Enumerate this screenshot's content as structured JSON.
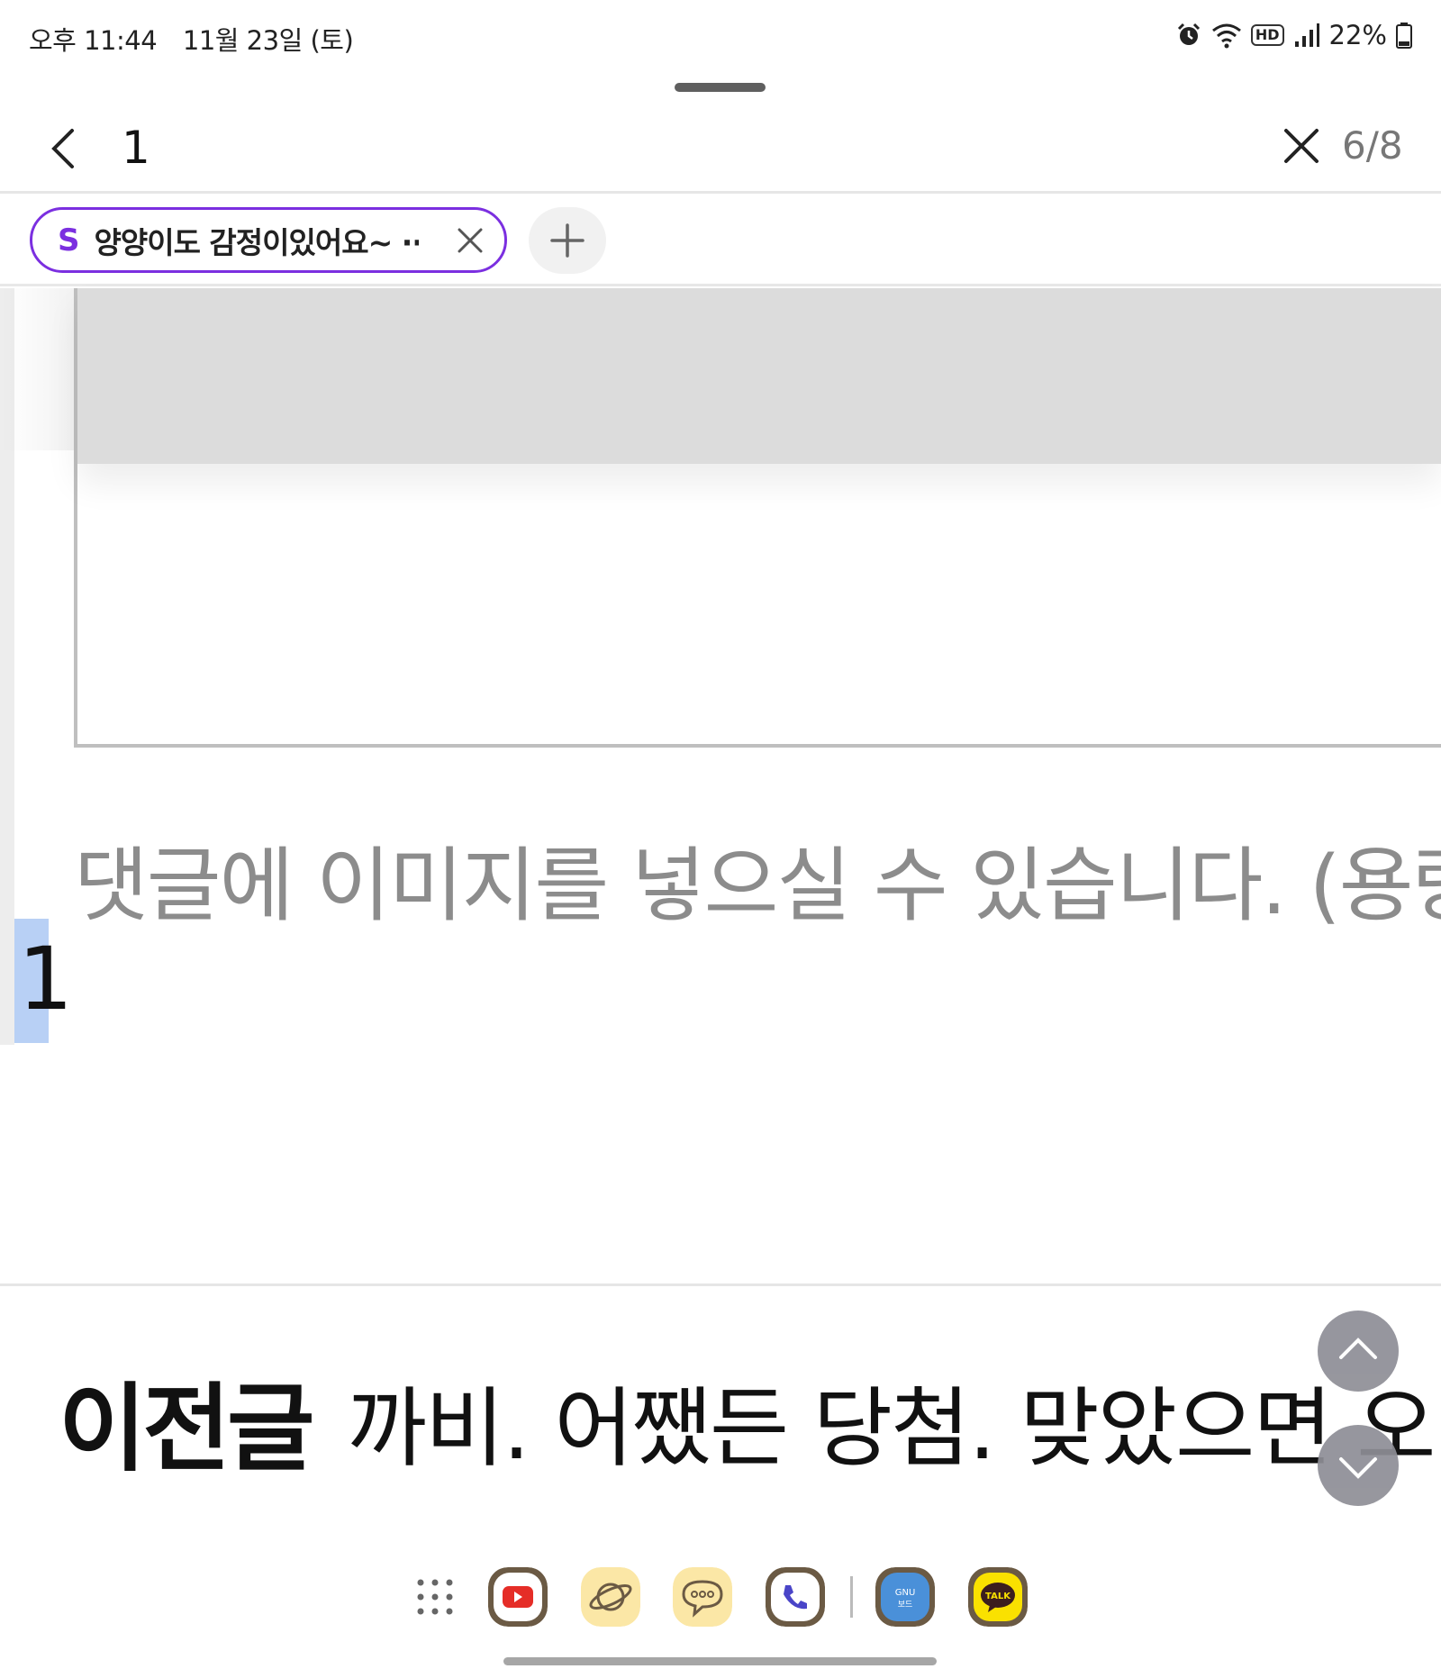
{
  "status_bar": {
    "time": "오후 11:44",
    "date": "11월 23일 (토)",
    "hd_label": "HD",
    "battery_percent": "22%"
  },
  "find_bar": {
    "query": "1",
    "match_count": "6/8"
  },
  "tab": {
    "icon_letter": "S",
    "title": "양양이도 감정이있어요~ ···"
  },
  "content": {
    "comment_placeholder": "댓글에 이미지를 넣으실 수 있습니다. (용량",
    "highlighted_match": "1"
  },
  "prev_post": {
    "label": "이전글",
    "text": "까비. 어쨌든 당첨. 맞았으면 오"
  },
  "colors": {
    "accent": "#7b2fe0",
    "highlight": "#b8d0f5",
    "scroll_button": "#8e8e96"
  },
  "dock": {
    "apps": [
      "grid-menu-icon",
      "youtube-icon",
      "internet-browser-icon",
      "messages-icon",
      "phone-icon",
      "gnu-board-icon",
      "kakaotalk-icon"
    ],
    "gnu_label_top": "GNU",
    "gnu_label_bottom": "보드",
    "kakao_label": "TALK"
  }
}
